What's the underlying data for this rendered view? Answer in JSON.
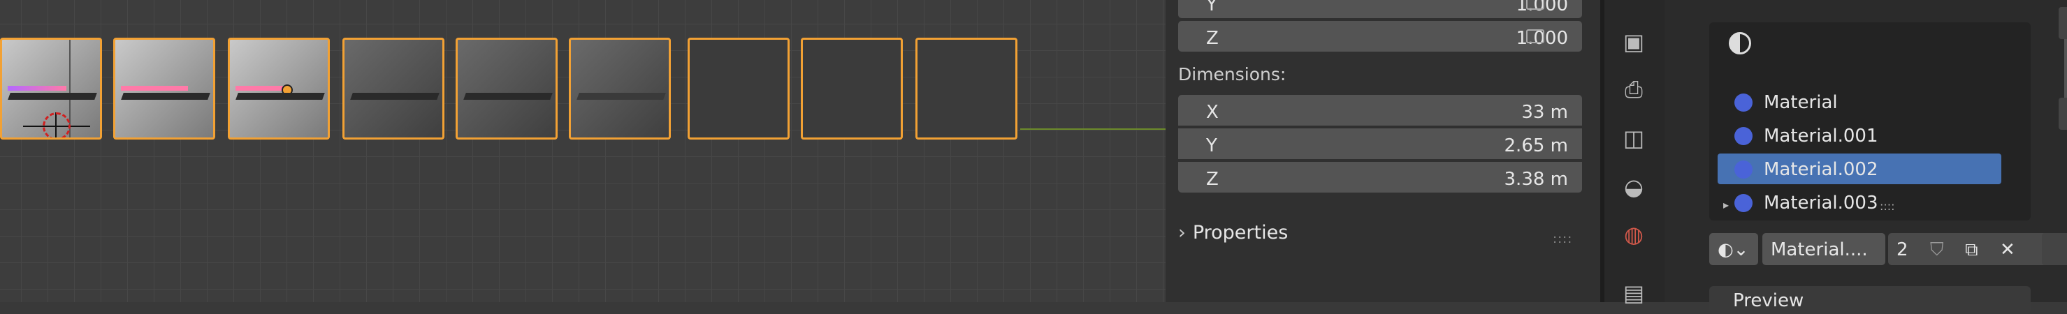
{
  "viewport": {
    "thumbnails": [
      "light-cursor",
      "light",
      "light-dot",
      "mid",
      "mid",
      "mid",
      "dark",
      "dark",
      "dark"
    ]
  },
  "transform": {
    "scale_y": {
      "label": "Y",
      "value": "1.000"
    },
    "scale_z": {
      "label": "Z",
      "value": "1.000"
    },
    "dimensions_label": "Dimensions:",
    "dim_x": {
      "label": "X",
      "value": "33 m"
    },
    "dim_y": {
      "label": "Y",
      "value": "2.65 m"
    },
    "dim_z": {
      "label": "Z",
      "value": "3.38 m"
    },
    "properties_label": "Properties",
    "drag_handle": "::::"
  },
  "material_slots": {
    "items": [
      {
        "name": "Material",
        "selected": false
      },
      {
        "name": "Material.001",
        "selected": false
      },
      {
        "name": "Material.002",
        "selected": true
      },
      {
        "name": "Material.003",
        "selected": false
      }
    ],
    "list_handle": "::::"
  },
  "material_bar": {
    "name": "Material....",
    "users": "2"
  },
  "preview_label": "Preview",
  "colors": {
    "selection_orange": "#f2a134",
    "selected_blue": "#4772b3",
    "material_ball": "#4a63d8",
    "x_axis_green": "#6c8b2a"
  }
}
